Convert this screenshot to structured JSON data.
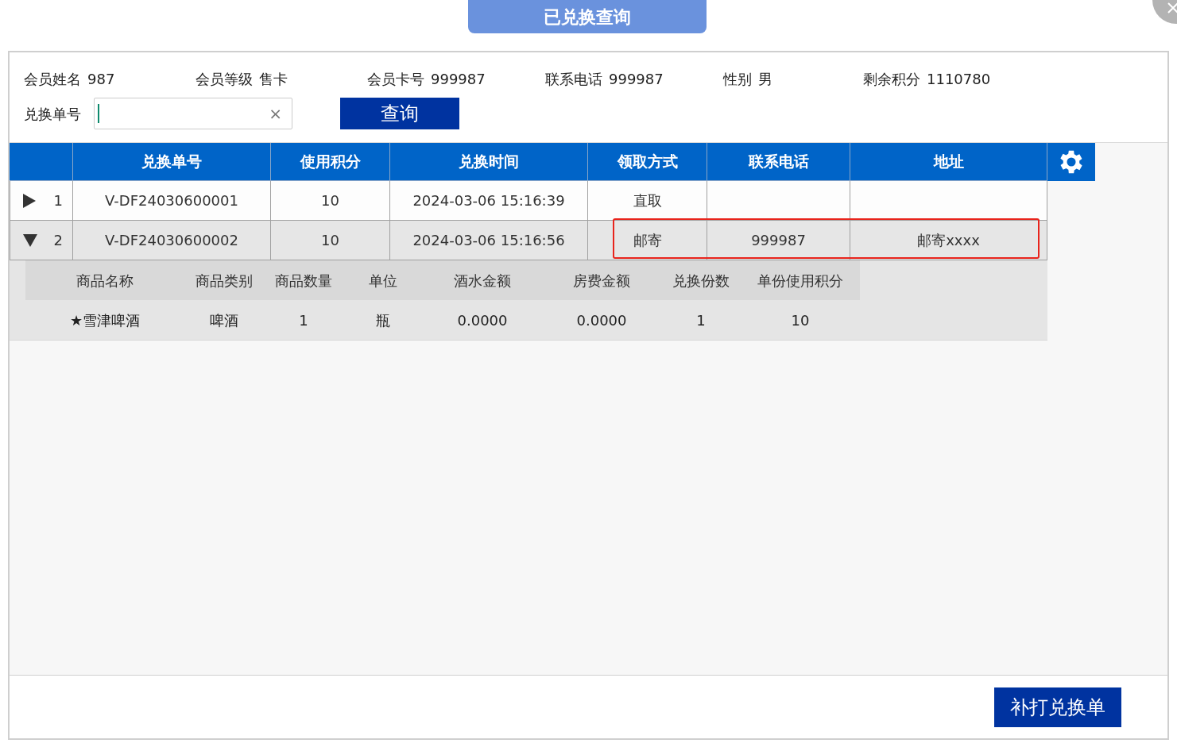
{
  "title": "已兑换查询",
  "member": [
    {
      "label": "会员姓名",
      "value": "987"
    },
    {
      "label": "会员等级",
      "value": "售卡"
    },
    {
      "label": "会员卡号",
      "value": "999987"
    },
    {
      "label": "联系电话",
      "value": "999987"
    },
    {
      "label": "性别",
      "value": "男"
    },
    {
      "label": "剩余积分",
      "value": "1110780"
    }
  ],
  "search": {
    "label": "兑换单号",
    "clear": "×",
    "button": "查询"
  },
  "table": {
    "columns": [
      "兑换单号",
      "使用积分",
      "兑换时间",
      "领取方式",
      "联系电话",
      "地址"
    ],
    "rows": [
      {
        "index": "1",
        "cells": [
          "V-DF24030600001",
          "10",
          "2024-03-06 15:16:39",
          "直取",
          "",
          ""
        ],
        "expanded": false,
        "selected": false,
        "highlighted": false
      },
      {
        "index": "2",
        "cells": [
          "V-DF24030600002",
          "10",
          "2024-03-06 15:16:56",
          "邮寄",
          "999987",
          "邮寄xxxx"
        ],
        "expanded": true,
        "selected": true,
        "highlighted": true,
        "detail": {
          "columns": [
            "商品名称",
            "商品类别",
            "商品数量",
            "单位",
            "酒水金额",
            "房费金额",
            "兑换份数",
            "单份使用积分"
          ],
          "rows": [
            [
              "★雪津啤酒",
              "啤酒",
              "1",
              "瓶",
              "0.0000",
              "0.0000",
              "1",
              "10"
            ]
          ]
        }
      }
    ]
  },
  "footer_button": "补打兑换单"
}
